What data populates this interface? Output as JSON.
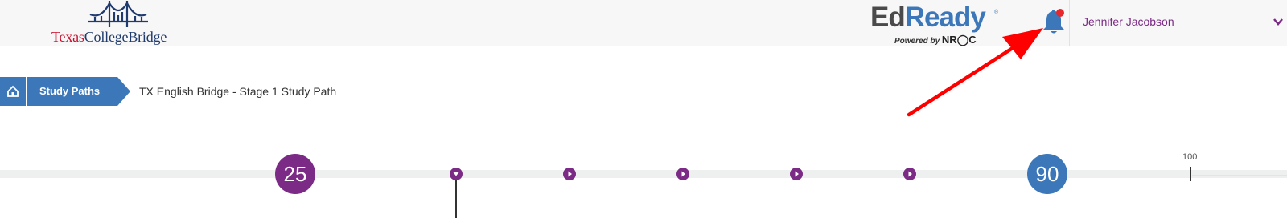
{
  "header": {
    "logo_tcb": {
      "part1": "Texas",
      "part2": "College",
      "part3": "Bridge"
    },
    "logo_edready": {
      "ed": "Ed",
      "ready": "Ready",
      "reg": "®",
      "powered_by": "Powered by",
      "nroc": "NR◯C"
    },
    "notification_icon": "bell-icon",
    "user": {
      "name": "Jennifer Jacobson"
    }
  },
  "breadcrumb": {
    "home_icon": "home-icon",
    "study_paths": "Study Paths",
    "current": "TX English Bridge - Stage 1 Study Path"
  },
  "timeline": {
    "start_score": "25",
    "target_score": "90",
    "max_label": "100",
    "unit_count": 5
  },
  "colors": {
    "purple": "#7b2a86",
    "blue": "#3c78b9",
    "annotation_red": "#ff0000"
  }
}
